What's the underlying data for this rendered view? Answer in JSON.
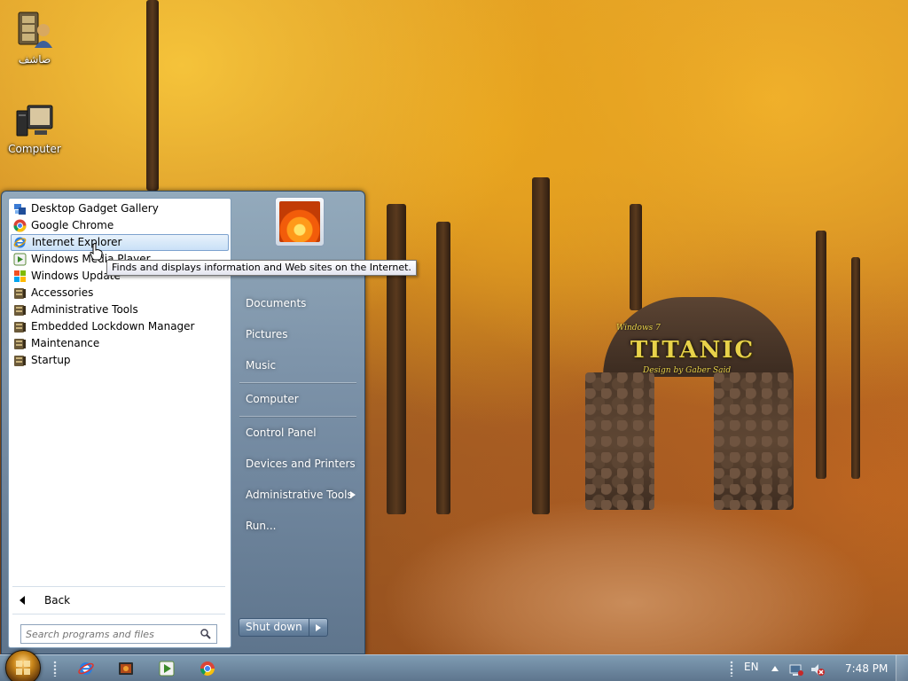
{
  "desktop": {
    "icons": [
      {
        "label": "صاشف",
        "icon": "user-folder-icon"
      },
      {
        "label": "Computer",
        "icon": "computer-icon"
      }
    ],
    "wallpaper": {
      "small": "Windows 7",
      "title": "TITANIC",
      "subtitle": "Design by Gaber Said"
    }
  },
  "start_menu": {
    "programs": [
      {
        "label": "Desktop Gadget Gallery",
        "icon": "gadget-icon"
      },
      {
        "label": "Google Chrome",
        "icon": "chrome-icon"
      },
      {
        "label": "Internet Explorer",
        "icon": "ie-icon",
        "hover": true
      },
      {
        "label": "Windows Media Player",
        "icon": "media-player-icon"
      },
      {
        "label": "Windows Update",
        "icon": "windows-update-icon"
      },
      {
        "label": "Accessories",
        "icon": "folder-icon"
      },
      {
        "label": "Administrative Tools",
        "icon": "folder-icon"
      },
      {
        "label": "Embedded Lockdown Manager",
        "icon": "folder-icon"
      },
      {
        "label": "Maintenance",
        "icon": "folder-icon"
      },
      {
        "label": "Startup",
        "icon": "folder-icon"
      }
    ],
    "back_label": "Back",
    "search_placeholder": "Search programs and files",
    "tooltip": "Finds and displays information and Web sites on the Internet.",
    "right_items": {
      "documents": "Documents",
      "pictures": "Pictures",
      "music": "Music",
      "computer": "Computer",
      "control_panel": "Control Panel",
      "devices": "Devices and Printers",
      "admin_tools": "Administrative Tools",
      "run": "Run..."
    },
    "shutdown_label": "Shut down"
  },
  "taskbar": {
    "pinned": [
      "ie-icon",
      "media-icon",
      "media-player-icon",
      "chrome-icon"
    ],
    "language": "EN",
    "time": "7:48 PM"
  },
  "colors": {
    "accent": "#7da2ce",
    "taskbar": "#6e8ca8"
  }
}
